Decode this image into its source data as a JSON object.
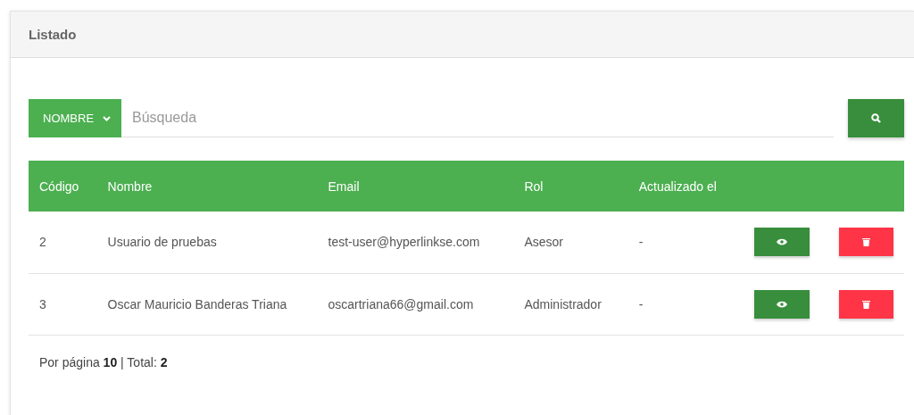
{
  "panel": {
    "title": "Listado"
  },
  "search": {
    "filter": "NOMBRE",
    "placeholder": "Búsqueda"
  },
  "table": {
    "columns": [
      "Código",
      "Nombre",
      "Email",
      "Rol",
      "Actualizado el"
    ],
    "rows": [
      {
        "cells": [
          "2",
          "Usuario de pruebas",
          "test-user@hyperlinkse.com",
          "Asesor",
          "-"
        ]
      },
      {
        "cells": [
          "3",
          "Oscar Mauricio Banderas Triana",
          "oscartriana66@gmail.com",
          "Administrador",
          "-"
        ]
      }
    ]
  },
  "footer": "Por página **10** | Total: **2**"
}
